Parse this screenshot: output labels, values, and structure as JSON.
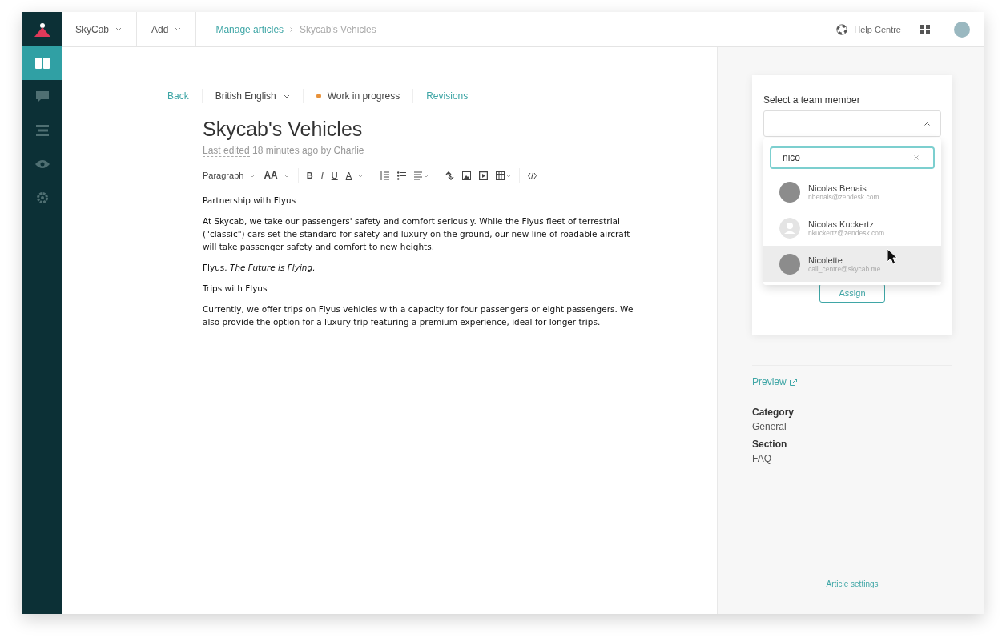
{
  "nav": {
    "items": [
      {
        "selected": true
      },
      {
        "selected": false
      },
      {
        "selected": false
      },
      {
        "selected": false
      },
      {
        "selected": false
      }
    ]
  },
  "topbar": {
    "brand": "SkyCab",
    "add": "Add",
    "breadcrumb": [
      "Manage articles",
      "Skycab's Vehicles"
    ],
    "help": "Help Centre"
  },
  "editor_bar": {
    "back": "Back",
    "language": "British English",
    "status": {
      "label": "Work in progress",
      "color": "#e8923a"
    },
    "revisions": "Revisions"
  },
  "article": {
    "title": "Skycab's Vehicles",
    "edited_label": "Last edited",
    "edited_rest": "18 minutes ago by Charlie",
    "toolbar": {
      "block_style": "Paragraph",
      "font_size": "AA",
      "bold": "B",
      "italic": "I",
      "underline": "U",
      "text_color": "A"
    },
    "body": [
      "Partnership with Flyus",
      "At Skycab, we take our passengers' safety and comfort seriously. While the Flyus fleet of terrestrial (\"classic\") cars set the standard for safety and luxury on the ground, our new line of roadable aircraft will take passenger safety and comfort to new heights.",
      "Flyus. *The Future is Flying.*",
      "Trips with Flyus",
      "Currently, we offer trips on Flyus vehicles with a capacity for four passengers or eight passengers. We also provide the option for a luxury trip featuring a premium experience, ideal for longer trips."
    ]
  },
  "assign": {
    "label": "Select a team member",
    "search": "nico",
    "button": "Assign",
    "options": [
      {
        "name": "Nicolas Benais",
        "email": "nbenais@zendesk.com",
        "kind": "photo",
        "selected": false
      },
      {
        "name": "Nicolas Kuckertz",
        "email": "nkuckertz@zendesk.com",
        "kind": "placeholder",
        "selected": false
      },
      {
        "name": "Nicolette",
        "email": "call_centre@skycab.me",
        "kind": "photo",
        "selected": true
      }
    ]
  },
  "sidebar": {
    "preview": "Preview",
    "fields": [
      {
        "label": "Category",
        "value": "General"
      },
      {
        "label": "Section",
        "value": "FAQ"
      }
    ],
    "settings": "Article settings"
  }
}
